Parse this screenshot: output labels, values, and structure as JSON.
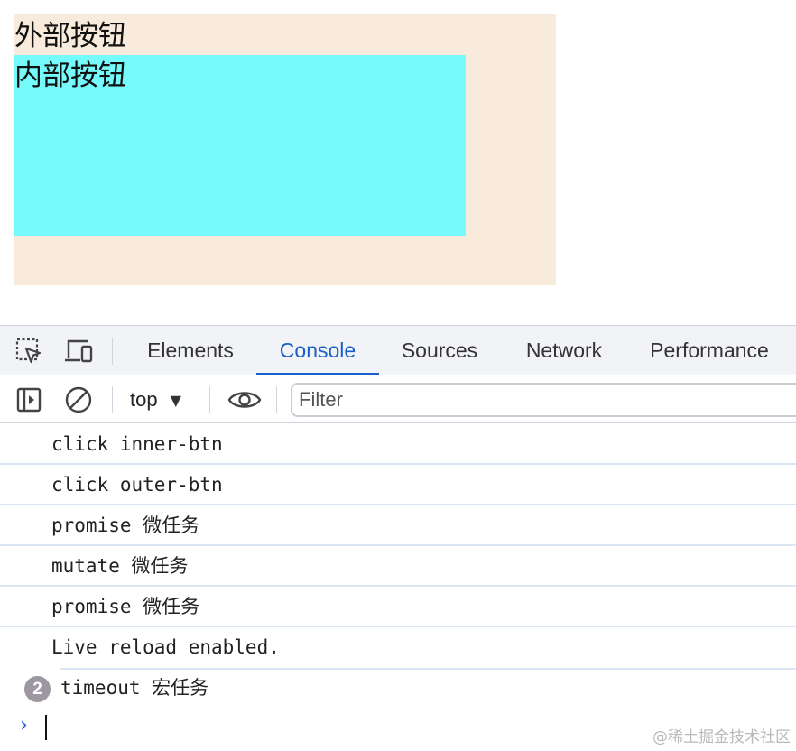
{
  "page": {
    "outer_button_label": "外部按钮",
    "inner_button_label": "内部按钮",
    "colors": {
      "outer_bg": "#f8ebdc",
      "inner_bg": "#76fbfd"
    }
  },
  "devtools": {
    "toolbar_icons": [
      "inspect-element-icon",
      "device-toolbar-icon"
    ],
    "tabs": [
      {
        "label": "Elements",
        "active": false
      },
      {
        "label": "Console",
        "active": true
      },
      {
        "label": "Sources",
        "active": false
      },
      {
        "label": "Network",
        "active": false
      },
      {
        "label": "Performance",
        "active": false
      }
    ],
    "console_toolbar": {
      "context": "top",
      "filter_placeholder": "Filter"
    },
    "messages": [
      {
        "text": "click inner-btn"
      },
      {
        "text": "click outer-btn"
      },
      {
        "text": "promise 微任务"
      },
      {
        "text": "mutate 微任务"
      },
      {
        "text": "promise 微任务"
      },
      {
        "text": "Live reload enabled."
      },
      {
        "text": "timeout 宏任务",
        "repeat_count": "2"
      }
    ],
    "accent": "#1a5fc8"
  },
  "watermark": "@稀土掘金技术社区"
}
